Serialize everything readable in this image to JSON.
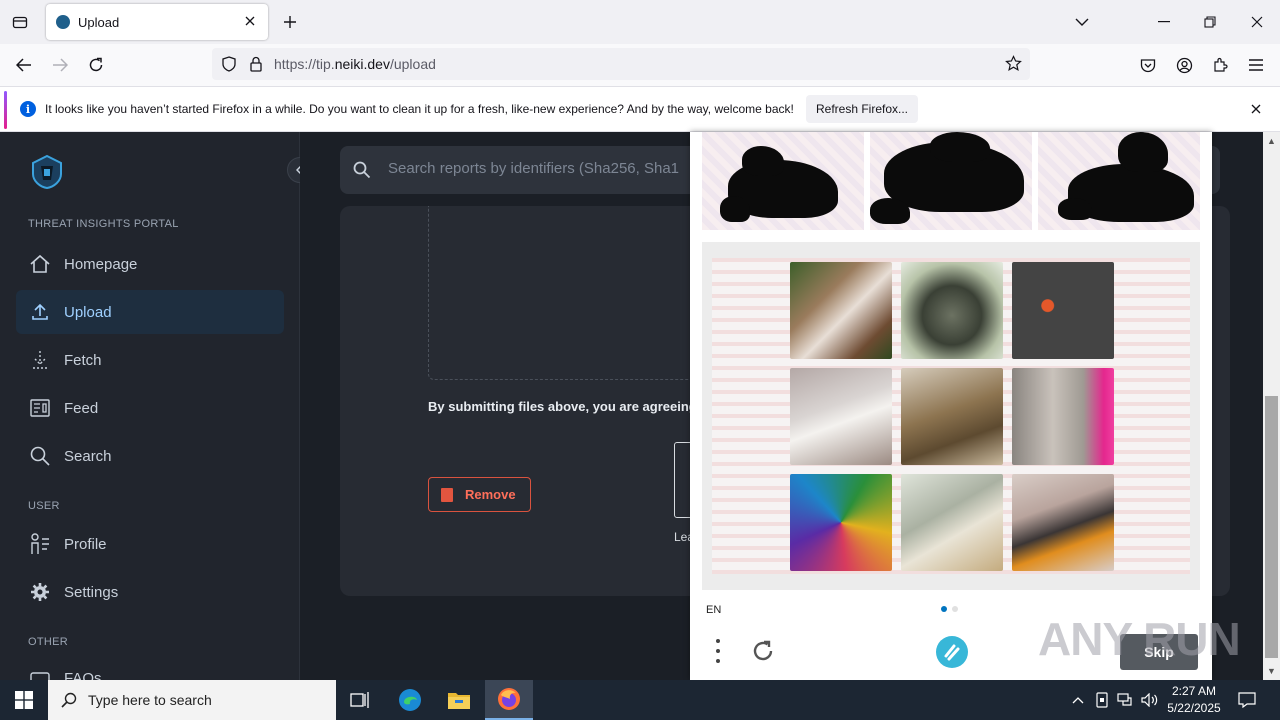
{
  "browser": {
    "tab_title": "Upload",
    "url_prefix": "https://tip.",
    "url_domain": "neiki.dev",
    "url_path": "/upload"
  },
  "notice": {
    "message": "It looks like you haven’t started Firefox in a while. Do you want to clean it up for a fresh, like-new experience? And by the way, welcome back!",
    "button_label": "Refresh Firefox..."
  },
  "sidebar": {
    "section_portal": "THREAT INSIGHTS PORTAL",
    "section_user": "USER",
    "section_other": "OTHER",
    "items": [
      {
        "label": "Homepage"
      },
      {
        "label": "Upload"
      },
      {
        "label": "Fetch"
      },
      {
        "label": "Feed"
      },
      {
        "label": "Search"
      },
      {
        "label": "Profile"
      },
      {
        "label": "Settings"
      },
      {
        "label": "FAQs"
      }
    ]
  },
  "main": {
    "search_placeholder": "Search reports by identifiers (Sha256, Sha1",
    "agree_text": "By submitting files above, you are agreeing to",
    "remove_label": "Remove",
    "learn_text": "Learn how"
  },
  "captcha": {
    "language": "EN",
    "skip_label": "Skip",
    "active_dot_color": "#0074bf",
    "inactive_dot_color": "#e0e0e0"
  },
  "watermark": "ANY RUN",
  "taskbar": {
    "search_placeholder": "Type here to search",
    "time": "2:27 AM",
    "date": "5/22/2025"
  }
}
